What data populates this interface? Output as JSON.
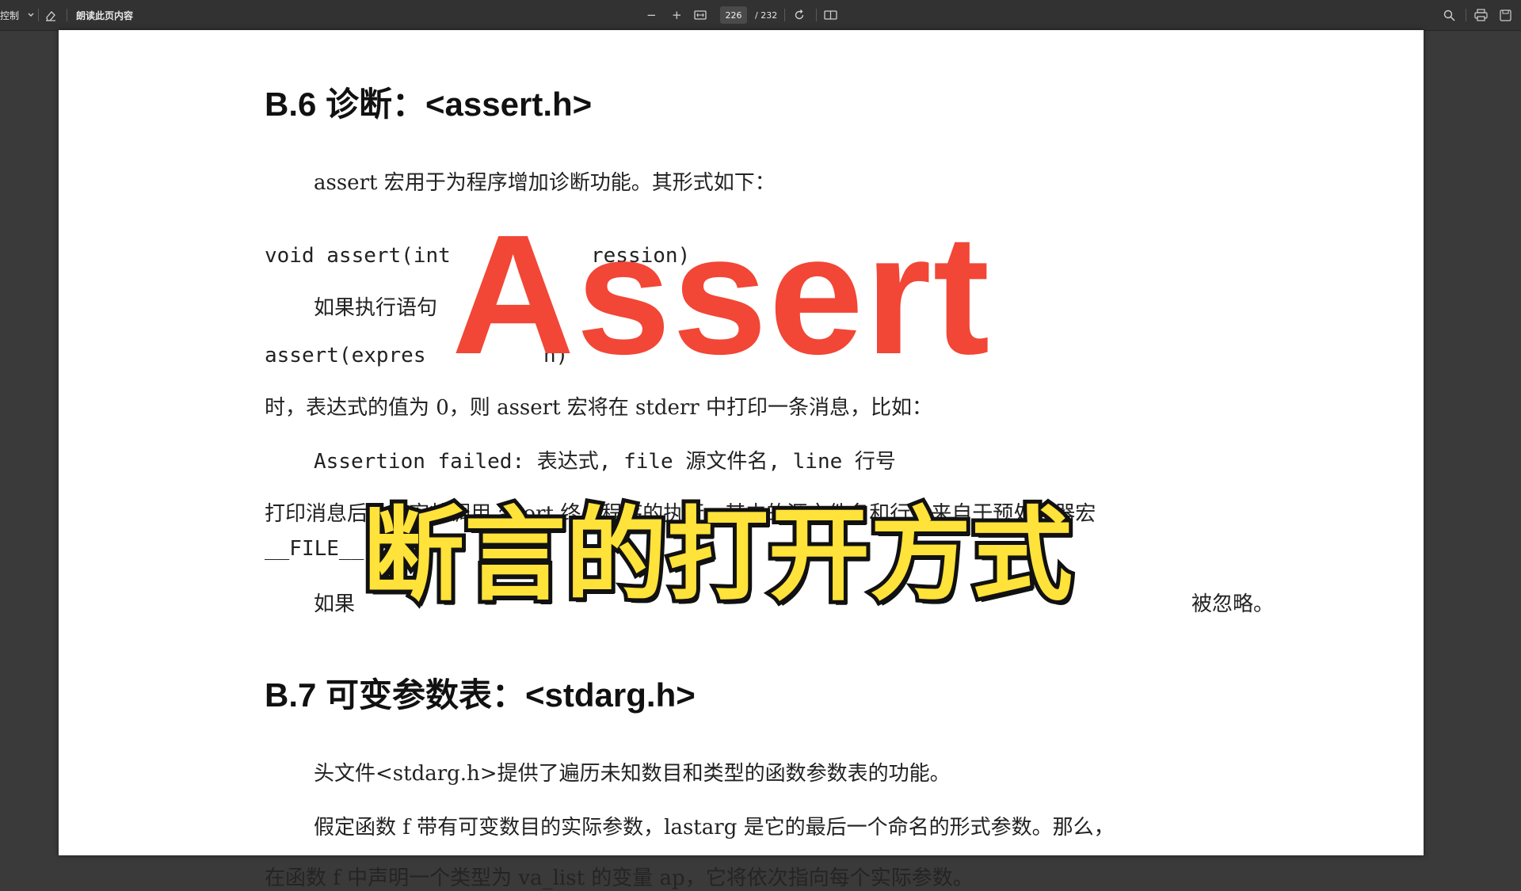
{
  "toolbar": {
    "left_label": "控制",
    "read_aloud": "朗读此页内容",
    "zoom_out": "−",
    "zoom_in": "+",
    "current_page": "226",
    "total_pages": "/ 232"
  },
  "document": {
    "b6_heading": "B.6    诊断：<assert.h>",
    "p1": "assert 宏用于为程序增加诊断功能。其形式如下：",
    "code1_a": "void assert(int",
    "code1_b": "ression)",
    "p2": "如果执行语句",
    "code2_a": "assert(expres",
    "code2_b": "n)",
    "p3": "时，表达式的值为 0，则 assert 宏将在 stderr 中打印一条消息，比如：",
    "p4": "Assertion failed: 表达式, file 源文件名, line 行号",
    "p5": "打印消息后，该宏将调用 abort 终止程序的执行。其中的源文件名和行号来自于预处理器宏",
    "p6": "__FILE__",
    "p7_a": "如果",
    "p7_b": "被忽略。",
    "b7_heading": "B.7    可变参数表：<stdarg.h>",
    "p8": "头文件<stdarg.h>提供了遍历未知数目和类型的函数参数表的功能。",
    "p9": "假定函数 f 带有可变数目的实际参数，lastarg 是它的最后一个命名的形式参数。那么，",
    "p10": "在函数 f 中声明一个类型为 va_list 的变量 ap，它将依次指向每个实际参数。"
  },
  "overlay": {
    "title_en": "Assert",
    "title_cn": "断言的打开方式",
    "title_en_color": "#f24636",
    "title_cn_color": "#ffe23a"
  }
}
